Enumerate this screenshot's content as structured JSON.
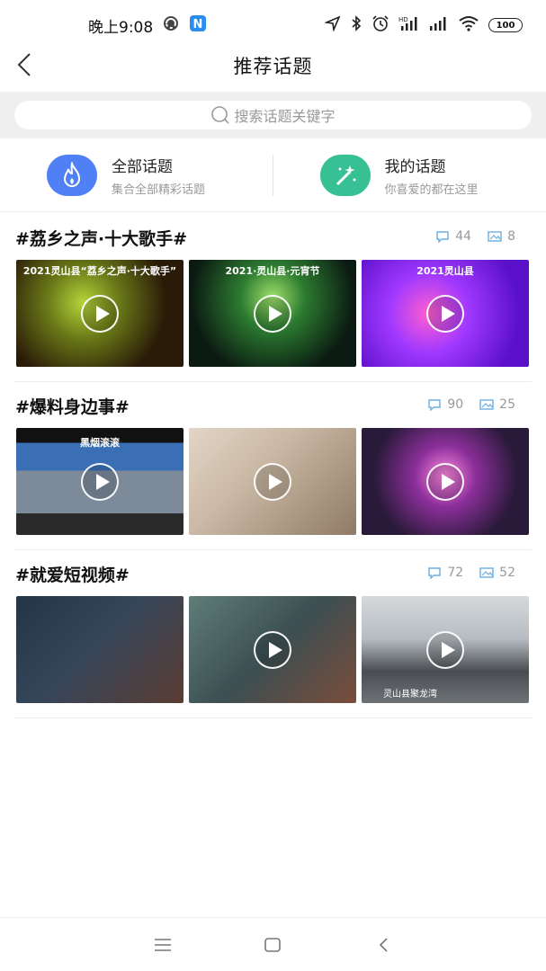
{
  "status": {
    "time": "晚上9:08",
    "battery": "100",
    "icons": [
      "sync-icon",
      "n-app-icon",
      "location-icon",
      "bluetooth-icon",
      "alarm-icon",
      "hd-signal-icon",
      "signal-icon",
      "wifi-icon",
      "battery-icon"
    ]
  },
  "nav": {
    "title": "推荐话题",
    "back_icon": "back-chevron-icon"
  },
  "search": {
    "placeholder": "搜索话题关键字"
  },
  "categories": [
    {
      "title": "全部话题",
      "subtitle": "集合全部精彩话题",
      "icon": "flame-icon",
      "color": "#4f80f5"
    },
    {
      "title": "我的话题",
      "subtitle": "你喜爱的都在这里",
      "icon": "magic-wand-icon",
      "color": "#38c095"
    }
  ],
  "topics": [
    {
      "title": "#荔乡之声·十大歌手#",
      "comments": "44",
      "images": "8",
      "thumbs": [
        {
          "banner": "2021灵山县“荔乡之声·十大歌手”"
        },
        {
          "banner": "2021·灵山县·元宵节"
        },
        {
          "banner": "2021灵山县"
        }
      ]
    },
    {
      "title": "#爆料身边事#",
      "comments": "90",
      "images": "25",
      "thumbs": [
        {
          "banner": "黑烟滚滚"
        },
        {
          "banner": ""
        },
        {
          "banner": ""
        }
      ]
    },
    {
      "title": "#就爱短视频#",
      "comments": "72",
      "images": "52",
      "thumbs": [
        {
          "banner": ""
        },
        {
          "banner": ""
        },
        {
          "banner": "",
          "caption": "灵山县聚龙湾"
        }
      ]
    }
  ],
  "bottom_nav": {
    "icons": [
      "menu-icon",
      "home-square-icon",
      "back-icon"
    ]
  }
}
